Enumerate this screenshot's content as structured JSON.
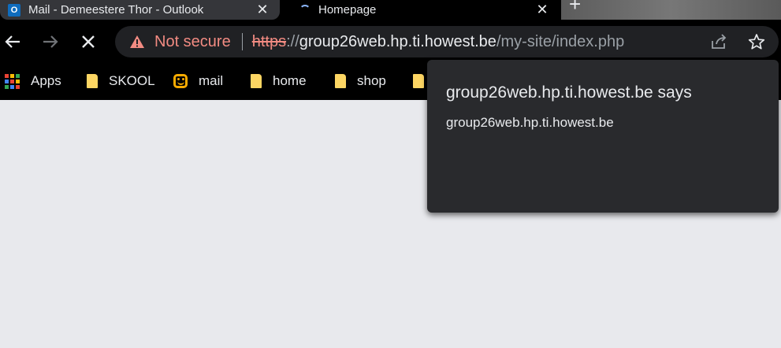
{
  "tabs": [
    {
      "title": "Mail - Demeestere Thor - Outlook",
      "favicon": "outlook-icon",
      "active": false
    },
    {
      "title": "Homepage",
      "favicon": "loading-spinner-icon",
      "active": true
    }
  ],
  "new_tab_icon": "plus-icon",
  "toolbar": {
    "back_icon": "arrow-left-icon",
    "forward_icon": "arrow-right-icon",
    "stop_icon": "close-icon",
    "security_label": "Not secure",
    "url": {
      "scheme": "https",
      "separator": "://",
      "host": "group26web.hp.ti.howest.be",
      "path": "/my-site/index.php"
    },
    "share_icon": "share-icon",
    "bookmark_icon": "star-icon"
  },
  "bookmarks": [
    {
      "label": "Apps",
      "icon": "apps-grid-icon"
    },
    {
      "label": "SKOOL",
      "icon": "folder-icon"
    },
    {
      "label": "mail",
      "icon": "mail-app-icon"
    },
    {
      "label": "home",
      "icon": "folder-icon"
    },
    {
      "label": "shop",
      "icon": "folder-icon"
    },
    {
      "label": "",
      "icon": "folder-icon"
    }
  ],
  "dialog": {
    "title": "group26web.hp.ti.howest.be says",
    "message": "group26web.hp.ti.howest.be"
  },
  "colors": {
    "page_background": "#e8e9ed",
    "chrome_background": "#000000",
    "omnibox_background": "#202124",
    "warning_red": "#f28b82",
    "dialog_background": "#292a2d",
    "folder_yellow": "#fdd663"
  }
}
